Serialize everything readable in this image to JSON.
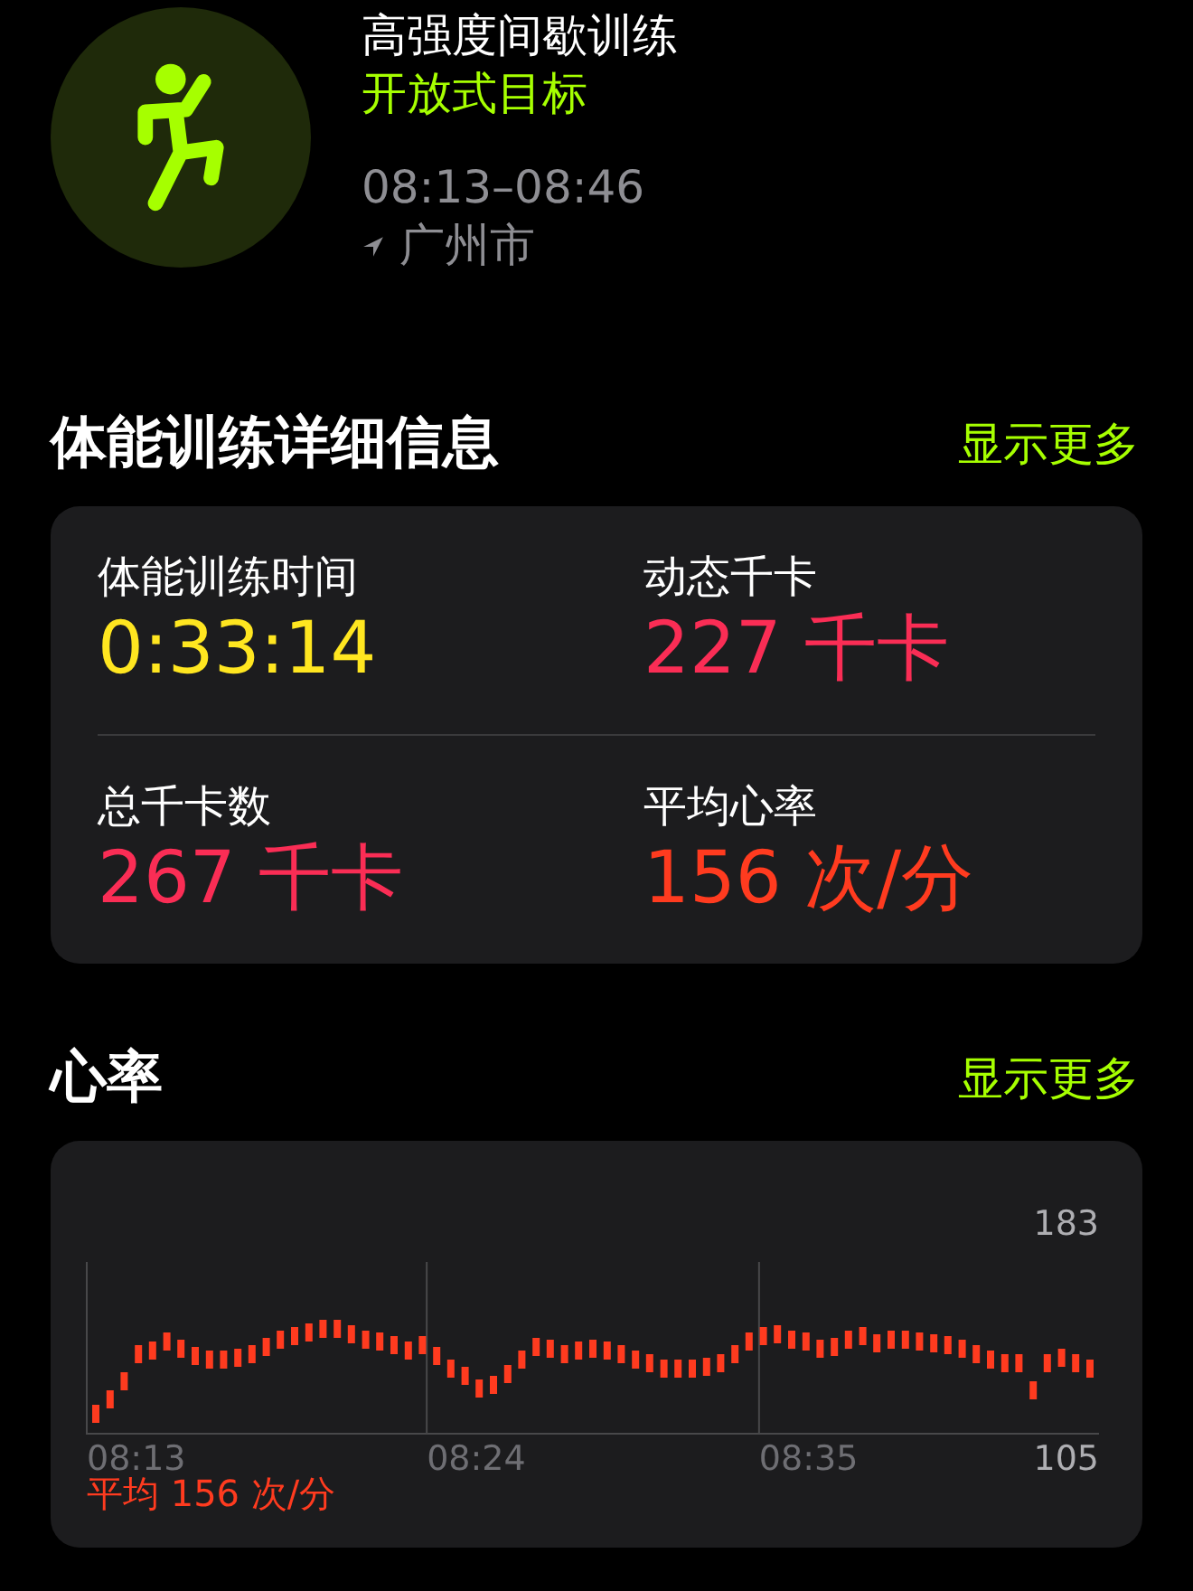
{
  "workout": {
    "title": "高强度间歇训练",
    "goal": "开放式目标",
    "time_range": "08:13–08:46",
    "location": "广州市"
  },
  "details": {
    "heading": "体能训练详细信息",
    "more_link": "显示更多",
    "metrics": [
      {
        "label": "体能训练时间",
        "value": "0:33:14",
        "color": "#ffe620"
      },
      {
        "label": "动态千卡",
        "value": "227 千卡",
        "color": "#fa2d55"
      },
      {
        "label": "总千卡数",
        "value": "267 千卡",
        "color": "#fa2d55"
      },
      {
        "label": "平均心率",
        "value": "156 次/分",
        "color": "#ff3b1f"
      }
    ]
  },
  "heart_rate": {
    "heading": "心率",
    "more_link": "显示更多",
    "average": "平均 156 次/分",
    "max_label": "183",
    "min_label": "105",
    "time_labels": [
      "08:13",
      "08:24",
      "08:35"
    ]
  }
}
